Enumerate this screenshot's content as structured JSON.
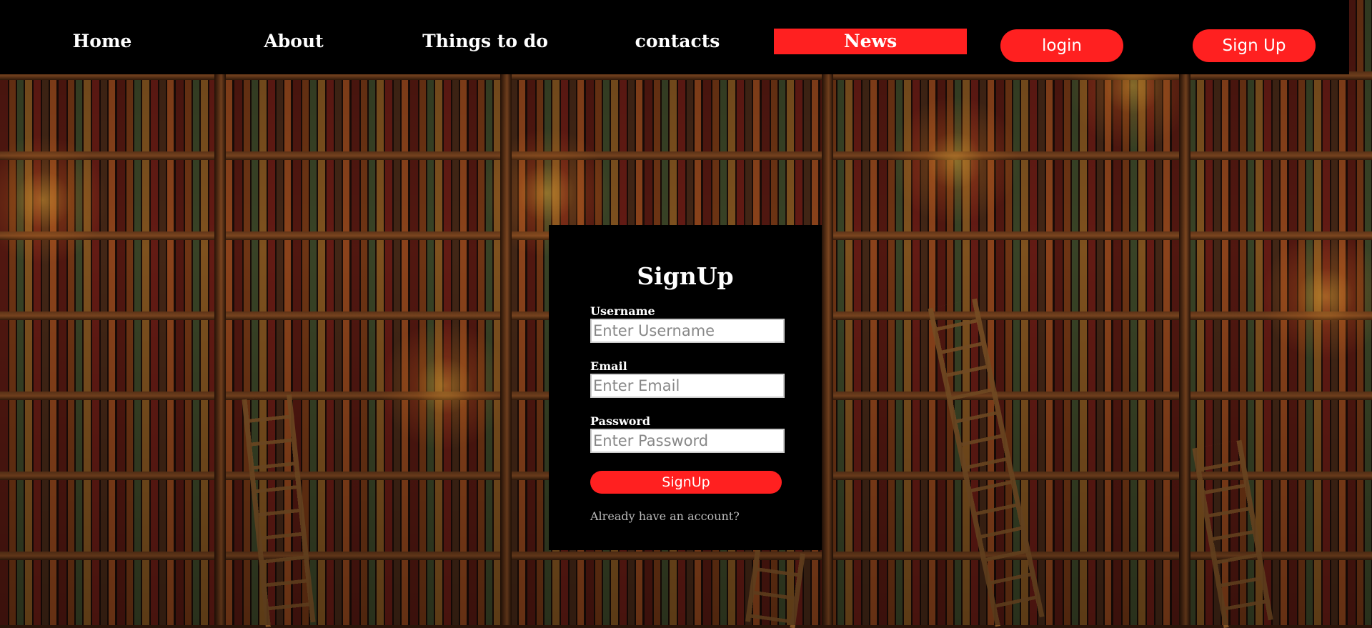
{
  "nav": {
    "links": [
      "Home",
      "About",
      "Things to do",
      "contacts",
      "News"
    ],
    "login_label": "login",
    "signup_label": "Sign Up"
  },
  "signup_form": {
    "title": "SignUp",
    "username_label": "Username",
    "username_placeholder": "Enter Username",
    "email_label": "Email",
    "email_placeholder": "Enter Email",
    "password_label": "Password",
    "password_placeholder": "Enter Password",
    "submit_label": "SignUp",
    "already_text": "Already have an account?"
  },
  "colors": {
    "accent": "#ff2020",
    "nav_bg": "#000000",
    "card_bg": "#000000"
  }
}
